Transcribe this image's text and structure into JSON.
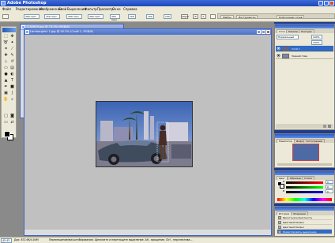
{
  "app": {
    "title": "Adobe Photoshop"
  },
  "menu": [
    "Файл",
    "Редактирование",
    "Изображение",
    "Слой",
    "Выделение",
    "Фильтр",
    "Просмотр",
    "Окно",
    "Справка"
  ],
  "options": {
    "field1": "300 пикс",
    "field2": "150 пикс",
    "field3": "300 пикс",
    "field4": "300 пикс",
    "field5": "300 пикс",
    "btn1": "Пере...",
    "btn2": "Соз...",
    "field6": "100",
    "field7": "100",
    "field8": "100",
    "btn3": "Сброс"
  },
  "tabwell": [
    "Файлы",
    "Инструменты",
    "Композиции слоев"
  ],
  "documents": [
    {
      "title": "7282609.jpg @ 73.3% (RGB/8)",
      "state": "inactive"
    },
    {
      "title": "Lamborghini 1.jpg @ 45.3% (Слой 1, RGB/8)",
      "state": "active"
    }
  ],
  "layers_panel": {
    "tabs": [
      "Слои",
      "Каналы",
      "Контуры"
    ],
    "mode": "Нормальный",
    "opacity": "100%",
    "fill": "100%",
    "layers": [
      {
        "name": "Слой 1",
        "selected": true
      },
      {
        "name": "Задний план",
        "selected": false
      }
    ]
  },
  "navigator_panel": {
    "tabs": [
      "Навигатор",
      "Инфо",
      "Гистограмма"
    ]
  },
  "color_panel": {
    "tabs": [
      "Цвет",
      "Образцы",
      "Стили"
    ],
    "channels": [
      "R",
      "G",
      "B"
    ],
    "values": [
      "0",
      "0",
      "0"
    ]
  },
  "history_panel": {
    "tabs": [
      "История",
      "Операции"
    ],
    "items": [
      {
        "label": "Яркость/контрастность",
        "selected": false
      },
      {
        "label": "Цветовой баланс",
        "selected": false
      },
      {
        "label": "Цветовой баланс",
        "selected": false
      },
      {
        "label": "Цветовой баланс",
        "selected": false
      },
      {
        "label": "Редактировать выделение",
        "selected": true
      }
    ]
  },
  "statusbar": {
    "zoom": "45.43 %",
    "doc": "Док: 872.6K/4.04M",
    "hint": "Перемещение/масштабирование. Щелкните и перетащите выделение. Alt - вращение, Ctrl - перспектива..."
  },
  "colors": {
    "accent": "#316ac5",
    "workspace": "#8a8a8a",
    "chrome": "#ece9d8",
    "desktop": "#1e3c8c"
  }
}
